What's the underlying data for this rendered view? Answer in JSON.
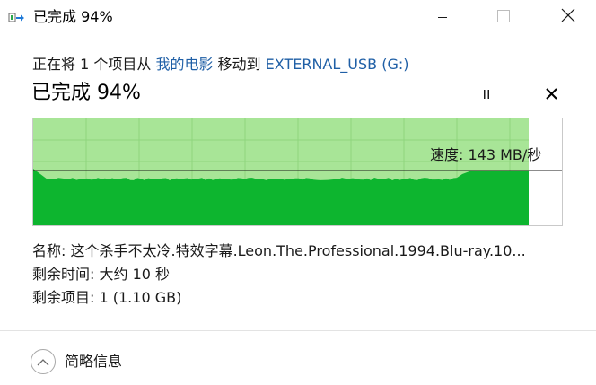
{
  "window": {
    "title": "已完成 94%"
  },
  "description": {
    "prefix": "正在将 1 个项目从 ",
    "source": "我的电影",
    "middle": " 移动到 ",
    "destination": "EXTERNAL_USB (G:)"
  },
  "progress": {
    "title": "已完成 94%",
    "percent": 94,
    "speed_label": "速度: 143 MB/秒"
  },
  "details": {
    "name_label": "名称: ",
    "name_value": "这个杀手不太冷.特效字幕.Leon.The.Professional.1994.Blu-ray.10...",
    "time_label": "剩余时间: ",
    "time_value": "大约 10 秒",
    "items_label": "剩余项目: ",
    "items_value": "1 (1.10 GB)"
  },
  "footer": {
    "collapse_label": "简略信息"
  },
  "colors": {
    "graph_fill": "#0db52f",
    "graph_progress_bg": "#a8e597",
    "grid": "#8fd57e",
    "link": "#1f5fa6"
  },
  "icons": {
    "app": "file-copy-icon",
    "minimize": "minimize-icon",
    "maximize": "maximize-icon",
    "close": "close-icon",
    "pause": "pause-icon",
    "cancel": "cancel-icon",
    "collapse": "chevron-up-icon"
  }
}
